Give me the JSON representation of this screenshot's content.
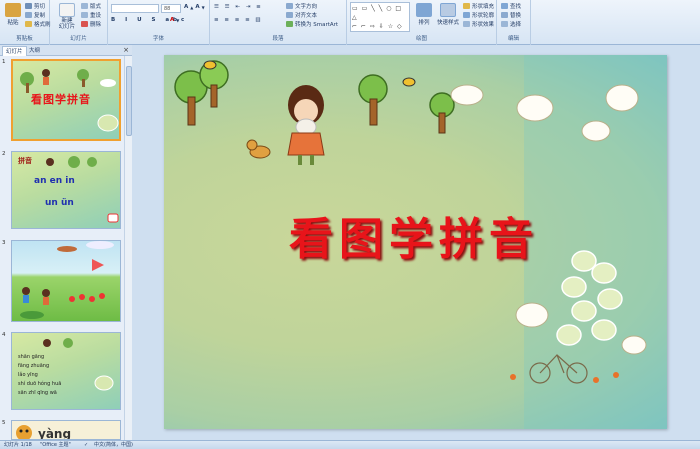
{
  "ribbon": {
    "clipboard": {
      "paste": "粘贴",
      "cut": "剪切",
      "copy": "复制",
      "format_painter": "格式刷",
      "label": "剪贴板"
    },
    "slides": {
      "new_slide": "新建\n幻灯片",
      "layout": "版式",
      "reset": "重设",
      "delete": "删除",
      "label": "幻灯片"
    },
    "font": {
      "font_size": "88",
      "label": "字体"
    },
    "paragraph": {
      "text_direction": "文字方向",
      "align_text": "对齐文本",
      "smartart": "转换为 SmartArt",
      "label": "段落"
    },
    "drawing": {
      "arrange": "排列",
      "quick_styles": "快速样式",
      "shape_fill": "形状填充",
      "shape_outline": "形状轮廓",
      "shape_effects": "形状效果",
      "label": "绘图"
    },
    "editing": {
      "find": "查找",
      "replace": "替换",
      "select": "选择",
      "label": "编辑"
    }
  },
  "sidebar": {
    "tabs": [
      "幻灯片",
      "大纲"
    ],
    "close": "×",
    "thumbnails": [
      {
        "num": "1",
        "title": "看图学拼音"
      },
      {
        "num": "2",
        "title": "拼音",
        "lines": [
          "an  en  in",
          "un  ün"
        ]
      },
      {
        "num": "3"
      },
      {
        "num": "4",
        "lines": [
          "shān gāng",
          "fāng zhuāng",
          "lǎo yīng",
          "shí duō hóng huā",
          "sān zhī qīng wā"
        ]
      },
      {
        "num": "5",
        "title": "yàng"
      }
    ]
  },
  "slide": {
    "title": "看图学拼音"
  },
  "status": {
    "slide_info": "幻灯片 1/18",
    "theme": "\"Office 主题\"",
    "language": "中文(简体，中国)"
  },
  "colors": {
    "title_red": "#e8141a",
    "selection_orange": "#f0a030",
    "ribbon_blue": "#d7e5f4"
  }
}
